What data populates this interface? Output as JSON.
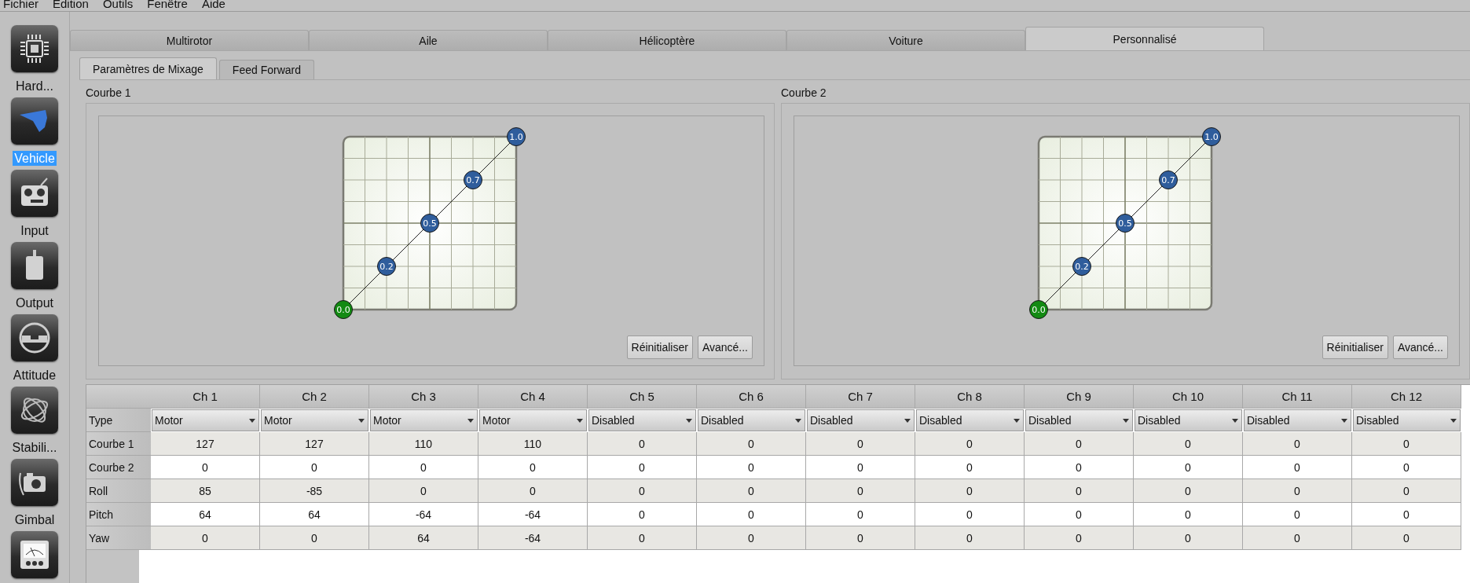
{
  "menu": [
    "Fichier",
    "Edition",
    "Outils",
    "Fenêtre",
    "Aide"
  ],
  "sidebar": {
    "items": [
      {
        "label": "Hard...",
        "selected": false
      },
      {
        "label": "Vehicle",
        "selected": true
      },
      {
        "label": "Input",
        "selected": false
      },
      {
        "label": "Output",
        "selected": false
      },
      {
        "label": "Attitude",
        "selected": false
      },
      {
        "label": "Stabili...",
        "selected": false
      },
      {
        "label": "Gimbal",
        "selected": false
      },
      {
        "selected": false
      }
    ]
  },
  "vehicle_tabs": [
    {
      "label": "Multirotor",
      "selected": false
    },
    {
      "label": "Aile",
      "selected": false
    },
    {
      "label": "Hélicoptère",
      "selected": false
    },
    {
      "label": "Voiture",
      "selected": false
    },
    {
      "label": "Personnalisé",
      "selected": true
    }
  ],
  "sub_tabs": [
    {
      "label": "Paramètres de Mixage",
      "selected": true
    },
    {
      "label": "Feed Forward",
      "selected": false
    }
  ],
  "curves": [
    {
      "title": "Courbe 1",
      "nodes": [
        {
          "label": "0.0",
          "color": "#138a13"
        },
        {
          "label": "0.2",
          "color": "#2f5d9c"
        },
        {
          "label": "0.5",
          "color": "#2f5d9c"
        },
        {
          "label": "0.7",
          "color": "#2f5d9c"
        },
        {
          "label": "1.0",
          "color": "#2f5d9c"
        }
      ],
      "buttons": [
        "Réinitialiser",
        "Avancé..."
      ]
    },
    {
      "title": "Courbe 2",
      "nodes": [
        {
          "label": "0.0",
          "color": "#138a13"
        },
        {
          "label": "0.2",
          "color": "#2f5d9c"
        },
        {
          "label": "0.5",
          "color": "#2f5d9c"
        },
        {
          "label": "0.7",
          "color": "#2f5d9c"
        },
        {
          "label": "1.0",
          "color": "#2f5d9c"
        }
      ],
      "buttons": [
        "Réinitialiser",
        "Avancé..."
      ]
    }
  ],
  "mixer_table": {
    "columns": [
      "Ch 1",
      "Ch 2",
      "Ch 3",
      "Ch 4",
      "Ch 5",
      "Ch 6",
      "Ch 7",
      "Ch 8",
      "Ch 9",
      "Ch 10",
      "Ch 11",
      "Ch 12"
    ],
    "type_row": {
      "label": "Type",
      "values": [
        "Motor",
        "Motor",
        "Motor",
        "Motor",
        "Disabled",
        "Disabled",
        "Disabled",
        "Disabled",
        "Disabled",
        "Disabled",
        "Disabled",
        "Disabled"
      ]
    },
    "rows": [
      {
        "label": "Courbe 1",
        "values": [
          "127",
          "127",
          "110",
          "110",
          "0",
          "0",
          "0",
          "0",
          "0",
          "0",
          "0",
          "0"
        ]
      },
      {
        "label": "Courbe 2",
        "values": [
          "0",
          "0",
          "0",
          "0",
          "0",
          "0",
          "0",
          "0",
          "0",
          "0",
          "0",
          "0"
        ]
      },
      {
        "label": "Roll",
        "values": [
          "85",
          "-85",
          "0",
          "0",
          "0",
          "0",
          "0",
          "0",
          "0",
          "0",
          "0",
          "0"
        ]
      },
      {
        "label": "Pitch",
        "values": [
          "64",
          "64",
          "-64",
          "-64",
          "0",
          "0",
          "0",
          "0",
          "0",
          "0",
          "0",
          "0"
        ]
      },
      {
        "label": "Yaw",
        "values": [
          "0",
          "0",
          "64",
          "-64",
          "0",
          "0",
          "0",
          "0",
          "0",
          "0",
          "0",
          "0"
        ]
      }
    ]
  }
}
